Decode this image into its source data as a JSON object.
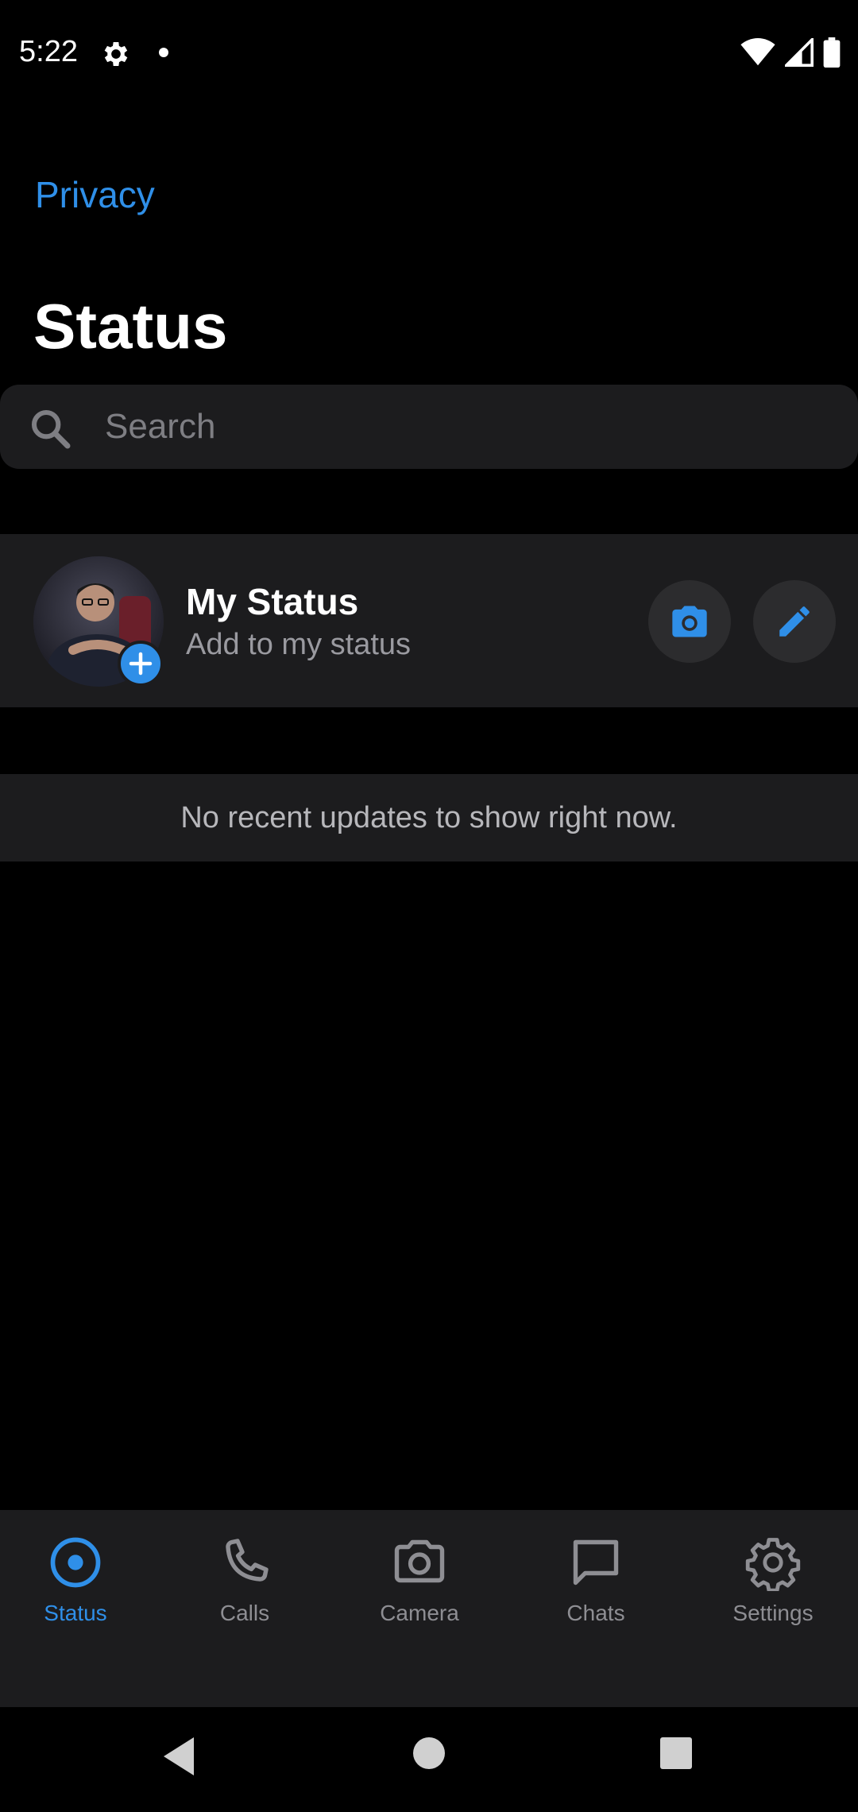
{
  "status_bar": {
    "time": "5:22"
  },
  "header": {
    "privacy_link": "Privacy",
    "title": "Status"
  },
  "search": {
    "placeholder": "Search"
  },
  "my_status": {
    "title": "My Status",
    "subtitle": "Add to my status"
  },
  "empty_state": {
    "message": "No recent updates to show right now."
  },
  "bottom_nav": {
    "items": [
      {
        "label": "Status",
        "icon": "status-ring-icon",
        "active": true
      },
      {
        "label": "Calls",
        "icon": "phone-icon",
        "active": false
      },
      {
        "label": "Camera",
        "icon": "camera-icon",
        "active": false
      },
      {
        "label": "Chats",
        "icon": "chat-bubble-icon",
        "active": false
      },
      {
        "label": "Settings",
        "icon": "gear-icon",
        "active": false
      }
    ]
  },
  "colors": {
    "accent": "#2f8fe8",
    "surface": "#1c1c1e",
    "background": "#000000"
  }
}
